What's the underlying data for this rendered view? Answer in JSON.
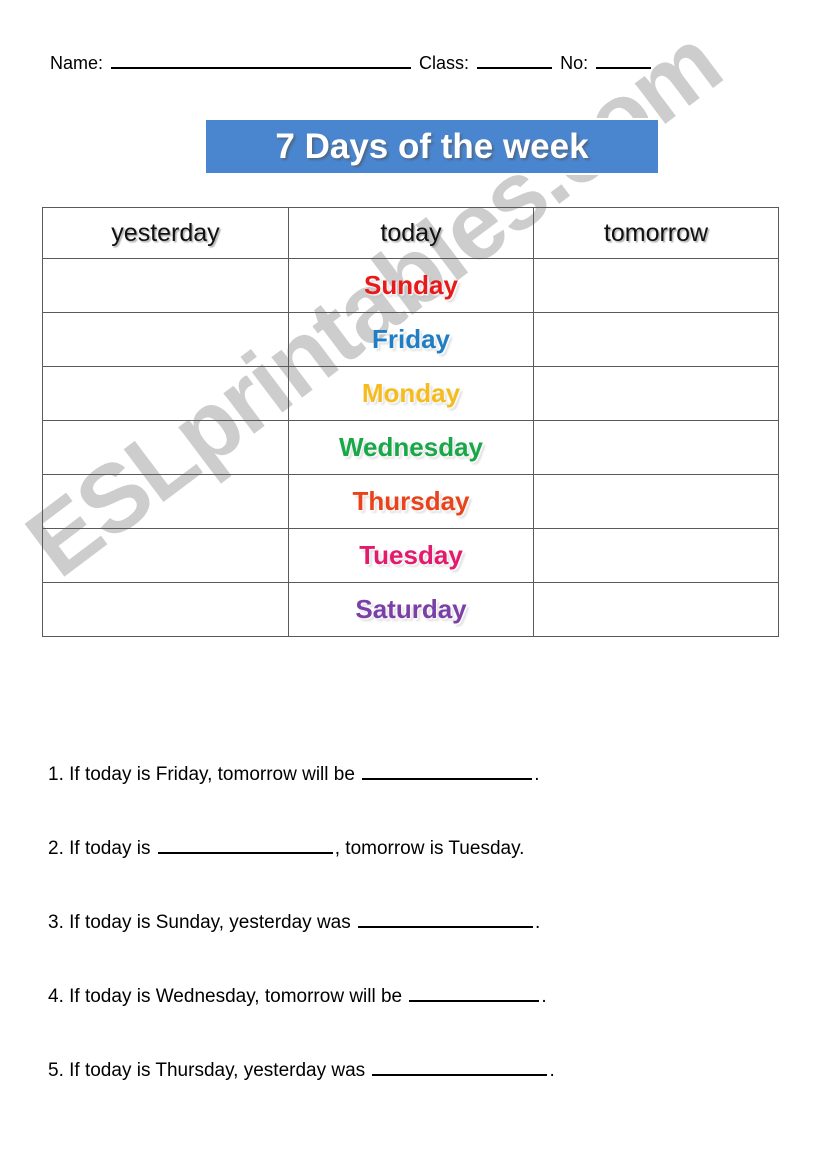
{
  "page": {
    "background_color": "#ffffff",
    "watermark": "ESLprintables.com",
    "watermark_color": "#c9c9c9"
  },
  "header": {
    "name_label": "Name:",
    "class_label": "Class:",
    "no_label": "No:"
  },
  "title": {
    "text": "7 Days of the week",
    "banner_color": "#4a86d0",
    "text_color": "#ffffff"
  },
  "table": {
    "columns": [
      "yesterday",
      "today",
      "tomorrow"
    ],
    "rows": [
      {
        "yesterday": "",
        "today": "Sunday",
        "tomorrow": "",
        "color": "#e8191b"
      },
      {
        "yesterday": "",
        "today": "Friday",
        "tomorrow": "",
        "color": "#1f7ec4"
      },
      {
        "yesterday": "",
        "today": "Monday",
        "tomorrow": "",
        "color": "#f5bc1f"
      },
      {
        "yesterday": "",
        "today": "Wednesday",
        "tomorrow": "",
        "color": "#19a74a"
      },
      {
        "yesterday": "",
        "today": "Thursday",
        "tomorrow": "",
        "color": "#e8431a"
      },
      {
        "yesterday": "",
        "today": "Tuesday",
        "tomorrow": "",
        "color": "#e31b6d"
      },
      {
        "yesterday": "",
        "today": "Saturday",
        "tomorrow": "",
        "color": "#7b3fa8"
      }
    ]
  },
  "questions": [
    {
      "number": "1.",
      "before": "If today is Friday, tomorrow will be",
      "blank_width": 170,
      "after": "."
    },
    {
      "number": "2.",
      "before": "If today is",
      "blank_width": 175,
      "after": ", tomorrow is Tuesday."
    },
    {
      "number": "3.",
      "before": "If today is Sunday, yesterday was",
      "blank_width": 175,
      "after": "."
    },
    {
      "number": "4.",
      "before": "If today is Wednesday, tomorrow will be",
      "blank_width": 130,
      "after": "."
    },
    {
      "number": "5.",
      "before": "If today is Thursday, yesterday was",
      "blank_width": 175,
      "after": "."
    }
  ]
}
